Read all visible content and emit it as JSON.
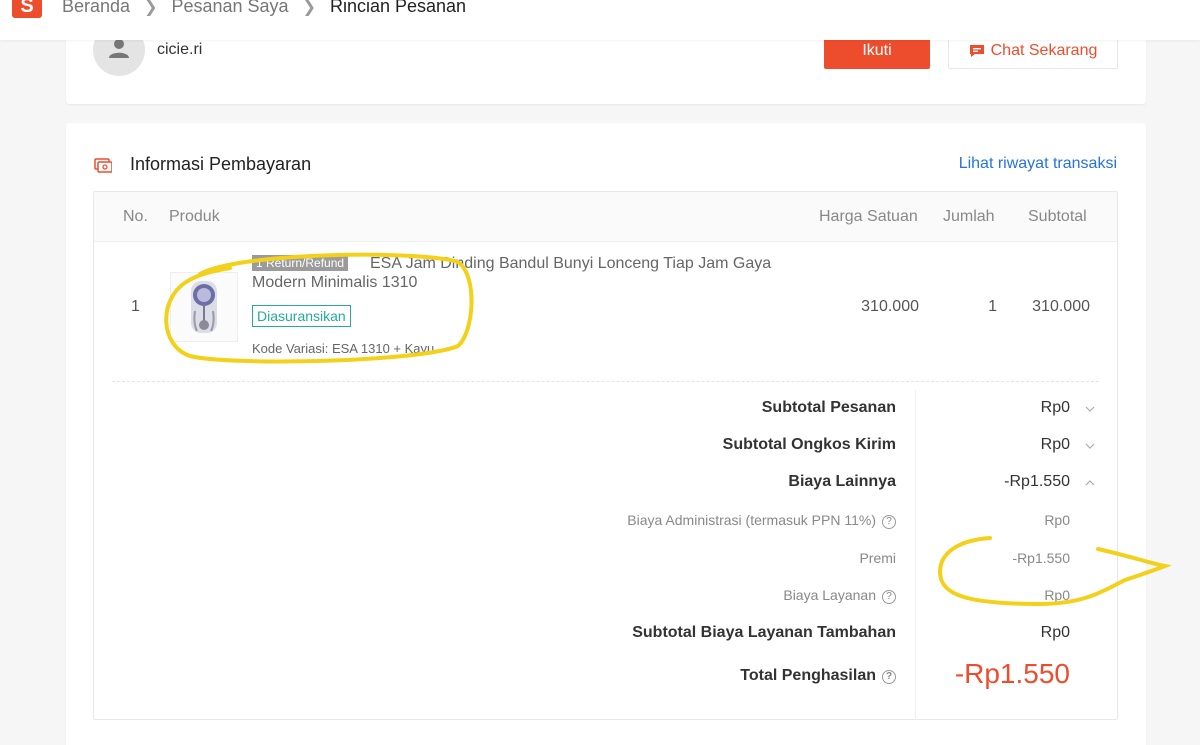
{
  "header": {
    "logo_text": "S",
    "breadcrumbs": [
      "Beranda",
      "Pesanan Saya",
      "Rincian Pesanan"
    ]
  },
  "shop": {
    "name": "cicie.ri",
    "follow_label": "Ikuti",
    "chat_label": "Chat Sekarang"
  },
  "payment": {
    "title": "Informasi Pembayaran",
    "history_link": "Lihat riwayat transaksi",
    "columns": {
      "no": "No.",
      "product": "Produk",
      "unit_price": "Harga Satuan",
      "qty": "Jumlah",
      "subtotal": "Subtotal"
    },
    "item": {
      "no": "1",
      "return_tag": "1 Return/Refund",
      "name": "ESA Jam Dinding Bandul Bunyi Lonceng Tiap Jam Gaya Modern Minimalis 1310",
      "insured_badge": "Diasuransikan",
      "variant": "Kode Variasi: ESA 1310 + Kayu",
      "unit_price": "310.000",
      "qty": "1",
      "subtotal": "310.000"
    },
    "summary": {
      "subtotal_order_label": "Subtotal Pesanan",
      "subtotal_order_value": "Rp0",
      "subtotal_shipping_label": "Subtotal Ongkos Kirim",
      "subtotal_shipping_value": "Rp0",
      "other_fees_label": "Biaya Lainnya",
      "other_fees_value": "-Rp1.550",
      "admin_fee_label": "Biaya Administrasi (termasuk PPN 11%)",
      "admin_fee_value": "Rp0",
      "premium_label": "Premi",
      "premium_value": "-Rp1.550",
      "service_fee_label": "Biaya Layanan",
      "service_fee_value": "Rp0",
      "extra_service_label": "Subtotal Biaya Layanan Tambahan",
      "extra_service_value": "Rp0",
      "total_label": "Total Penghasilan",
      "total_value": "-Rp1.550"
    }
  },
  "colors": {
    "brand": "#ee4d2d",
    "link": "#2673dd",
    "insured": "#26aa99",
    "annotation": "#f3d11a"
  }
}
